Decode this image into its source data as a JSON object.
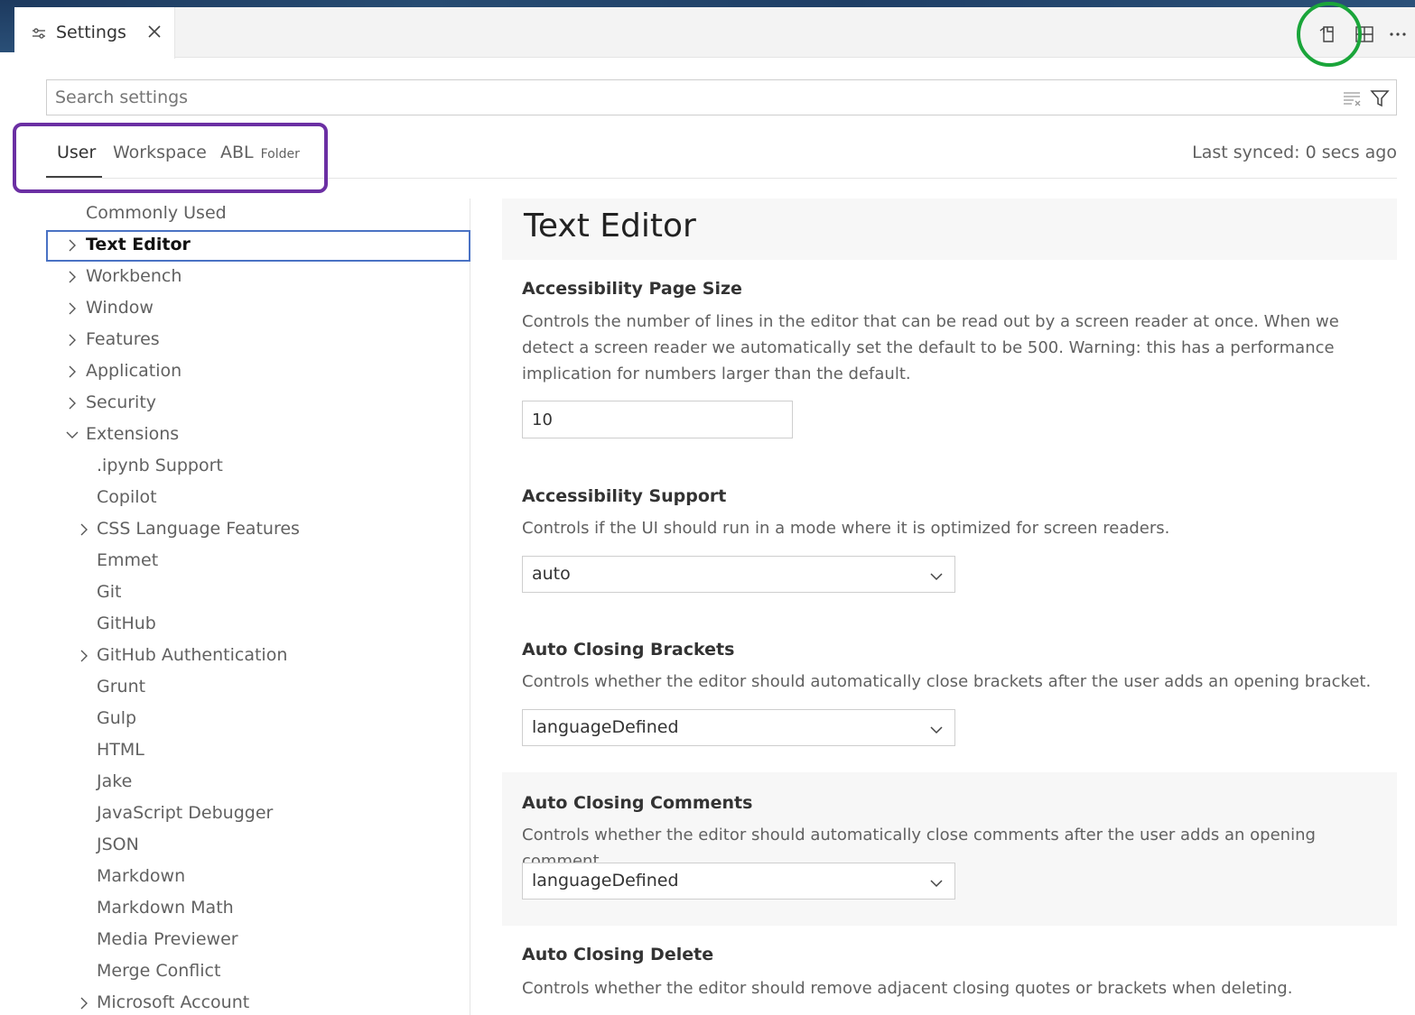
{
  "tab": {
    "label": "Settings"
  },
  "search": {
    "placeholder": "Search settings"
  },
  "scopes": {
    "user": "User",
    "workspace": "Workspace",
    "abl": "ABL",
    "abl_sub": "Folder",
    "last_synced": "Last synced: 0 secs ago"
  },
  "toc": [
    {
      "label": "Commonly Used",
      "chevron": "none",
      "indent": 0
    },
    {
      "label": "Text Editor",
      "chevron": "right",
      "indent": 0,
      "selected": true
    },
    {
      "label": "Workbench",
      "chevron": "right",
      "indent": 0
    },
    {
      "label": "Window",
      "chevron": "right",
      "indent": 0
    },
    {
      "label": "Features",
      "chevron": "right",
      "indent": 0
    },
    {
      "label": "Application",
      "chevron": "right",
      "indent": 0
    },
    {
      "label": "Security",
      "chevron": "right",
      "indent": 0
    },
    {
      "label": "Extensions",
      "chevron": "down",
      "indent": 0
    },
    {
      "label": ".ipynb Support",
      "chevron": "none",
      "indent": 1
    },
    {
      "label": "Copilot",
      "chevron": "none",
      "indent": 1
    },
    {
      "label": "CSS Language Features",
      "chevron": "right",
      "indent": 1
    },
    {
      "label": "Emmet",
      "chevron": "none",
      "indent": 1
    },
    {
      "label": "Git",
      "chevron": "none",
      "indent": 1
    },
    {
      "label": "GitHub",
      "chevron": "none",
      "indent": 1
    },
    {
      "label": "GitHub Authentication",
      "chevron": "right",
      "indent": 1
    },
    {
      "label": "Grunt",
      "chevron": "none",
      "indent": 1
    },
    {
      "label": "Gulp",
      "chevron": "none",
      "indent": 1
    },
    {
      "label": "HTML",
      "chevron": "none",
      "indent": 1
    },
    {
      "label": "Jake",
      "chevron": "none",
      "indent": 1
    },
    {
      "label": "JavaScript Debugger",
      "chevron": "none",
      "indent": 1
    },
    {
      "label": "JSON",
      "chevron": "none",
      "indent": 1
    },
    {
      "label": "Markdown",
      "chevron": "none",
      "indent": 1
    },
    {
      "label": "Markdown Math",
      "chevron": "none",
      "indent": 1
    },
    {
      "label": "Media Previewer",
      "chevron": "none",
      "indent": 1
    },
    {
      "label": "Merge Conflict",
      "chevron": "none",
      "indent": 1
    },
    {
      "label": "Microsoft Account",
      "chevron": "right",
      "indent": 1
    }
  ],
  "section_title": "Text Editor",
  "settings": {
    "page_size": {
      "title": "Accessibility Page Size",
      "desc": "Controls the number of lines in the editor that can be read out by a screen reader at once. When we detect a screen reader we automatically set the default to be 500. Warning: this has a performance implication for numbers larger than the default.",
      "value": "10"
    },
    "support": {
      "title": "Accessibility Support",
      "desc": "Controls if the UI should run in a mode where it is optimized for screen readers.",
      "value": "auto"
    },
    "brackets": {
      "title": "Auto Closing Brackets",
      "desc": "Controls whether the editor should automatically close brackets after the user adds an opening bracket.",
      "value": "languageDefined"
    },
    "comments": {
      "title": "Auto Closing Comments",
      "desc": "Controls whether the editor should automatically close comments after the user adds an opening comment.",
      "value": "languageDefined"
    },
    "delete": {
      "title": "Auto Closing Delete",
      "desc": "Controls whether the editor should remove adjacent closing quotes or brackets when deleting."
    }
  },
  "colors": {
    "accent_focus": "#4a72c4",
    "annotation_green": "#1aa53a",
    "annotation_purple": "#6b2fa3"
  },
  "icons": [
    "settings-sliders-icon",
    "close-icon",
    "open-settings-json-icon",
    "split-editor-icon",
    "more-actions-icon",
    "clear-filter-icon",
    "filter-icon",
    "chevron-right-icon",
    "chevron-down-icon"
  ]
}
